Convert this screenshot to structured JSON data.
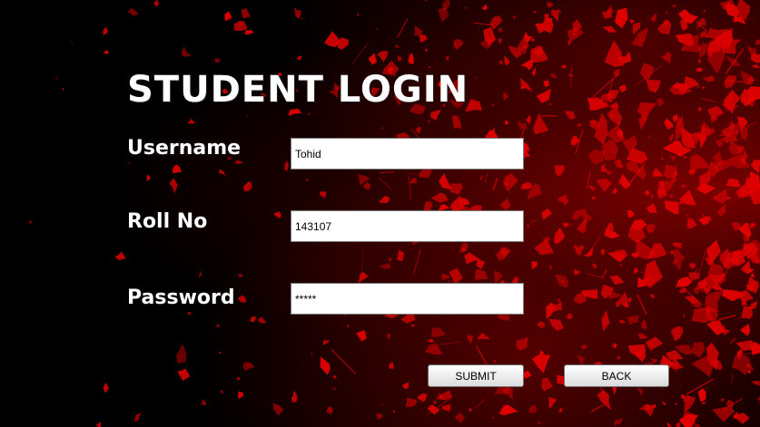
{
  "title": "STUDENT LOGIN",
  "form": {
    "username": {
      "label": "Username",
      "value": "Tohid"
    },
    "roll_no": {
      "label": "Roll No",
      "value": "143107"
    },
    "password": {
      "label": "Password",
      "value": "*****"
    }
  },
  "buttons": {
    "submit_label": "SUBMIT",
    "back_label": "BACK"
  },
  "colors": {
    "background": "#000000",
    "splatter": "#e00000",
    "text": "#ffffff"
  }
}
